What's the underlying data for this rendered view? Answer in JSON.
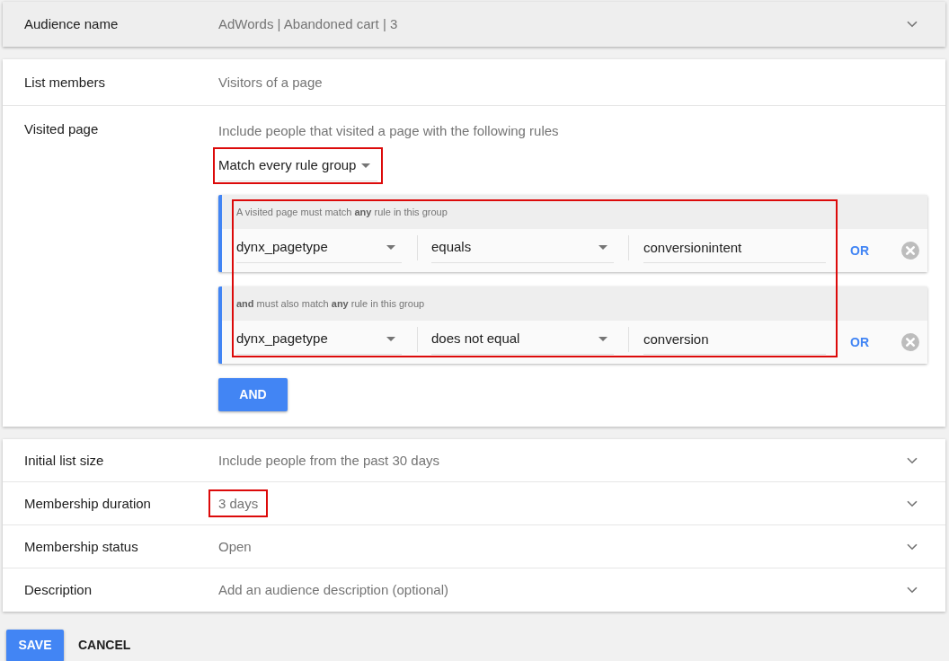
{
  "audience_name": {
    "label": "Audience name",
    "value": "AdWords | Abandoned cart | 3"
  },
  "list_members": {
    "label": "List members",
    "value": "Visitors of a page"
  },
  "visited_page": {
    "label": "Visited page",
    "description": "Include people that visited a page with the following rules",
    "match_dropdown": {
      "value": "Match every rule group",
      "highlighted": true
    },
    "rule_groups": {
      "highlighted": true,
      "groups": [
        {
          "heading": "A visited page must match **any** rule in this group",
          "rules": [
            {
              "variable": "dynx_pagetype",
              "operator": "equals",
              "value": "conversionintent",
              "or_button": "OR"
            }
          ]
        },
        {
          "heading": "**and** must also match **any** rule in this group",
          "rules": [
            {
              "variable": "dynx_pagetype",
              "operator": "does not equal",
              "value": "conversion",
              "or_button": "OR"
            }
          ]
        }
      ]
    },
    "and_button": "AND"
  },
  "settings": [
    {
      "label": "Initial list size",
      "value": "Include people from the past 30 days",
      "highlighted": false
    },
    {
      "label": "Membership duration",
      "value": "3 days",
      "highlighted": true
    },
    {
      "label": "Membership status",
      "value": "Open",
      "highlighted": false
    },
    {
      "label": "Description",
      "value": "Add an audience description (optional)",
      "highlighted": false
    }
  ],
  "actions": {
    "save": "SAVE",
    "cancel": "CANCEL"
  }
}
